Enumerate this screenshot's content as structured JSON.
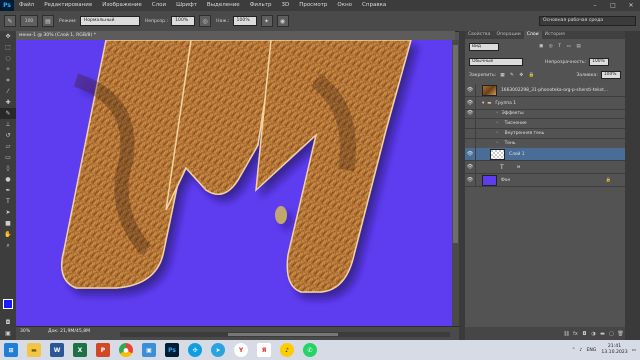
{
  "app": {
    "logo": "Ps"
  },
  "menu": [
    "Файл",
    "Редактирование",
    "Изображение",
    "Слои",
    "Шрифт",
    "Выделение",
    "Фильтр",
    "3D",
    "Просмотр",
    "Окно",
    "Справка"
  ],
  "options": {
    "size": "100",
    "mode_label": "Режим:",
    "mode_value": "Нормальный",
    "opacity_label": "Непрозр.:",
    "opacity_value": "100%",
    "flow_label": "Наж.:",
    "flow_value": "100%",
    "workspace": "Основная рабочая среда"
  },
  "tools": [
    "move-tool-icon",
    "marquee-tool-icon",
    "lasso-tool-icon",
    "quick-select-icon",
    "crop-tool-icon",
    "eyedropper-icon",
    "healing-brush-icon",
    "brush-tool-icon",
    "clone-stamp-icon",
    "history-brush-icon",
    "eraser-icon",
    "gradient-icon",
    "blur-icon",
    "dodge-icon",
    "pen-tool-icon",
    "type-tool-icon",
    "path-select-icon",
    "shape-tool-icon",
    "hand-tool-icon",
    "zoom-tool-icon"
  ],
  "document": {
    "tab_title": "мени-1 @ 30% (Слой 1, RGB/8) *",
    "zoom": "30%",
    "docsize": "Док: 21,9М/45,8М"
  },
  "canvas": {
    "background_color": "#5e3df0",
    "letter": "М"
  },
  "panel": {
    "tabs": [
      "Свойства",
      "Операции",
      "Слои",
      "История"
    ],
    "active_tab": "Слои",
    "filter_kind": "Вид",
    "blend_mode": "Обычные",
    "opacity_label": "Непрозрачность:",
    "opacity_value": "100%",
    "lock_label": "Закрепить:",
    "fill_label": "Заливка:",
    "fill_value": "100%"
  },
  "layers": [
    {
      "name": "1663002298_31-phonoteka-org-p-shersti-tekst...",
      "type": "image",
      "indent": 0
    },
    {
      "name": "Группа 1",
      "type": "group",
      "indent": 0
    },
    {
      "name": "Эффекты",
      "type": "fx",
      "indent": 1
    },
    {
      "name": "Тиснение",
      "type": "fx",
      "indent": 2
    },
    {
      "name": "Внутренняя тень",
      "type": "fx",
      "indent": 2
    },
    {
      "name": "Тень",
      "type": "fx",
      "indent": 2
    },
    {
      "name": "Слой 1",
      "type": "pixel",
      "indent": 1,
      "selected": true
    },
    {
      "name": "м",
      "type": "text",
      "indent": 1
    },
    {
      "name": "Фон",
      "type": "background",
      "indent": 0
    }
  ],
  "taskbar": {
    "apps": [
      "windows-start-icon",
      "file-explorer-icon",
      "word-icon",
      "excel-icon",
      "powerpoint-icon",
      "chrome-icon",
      "photos-icon",
      "photoshop-icon",
      "network-icon",
      "telegram-icon",
      "yandex-icon",
      "yandex-browser-icon",
      "yandex-music-icon",
      "whatsapp-icon"
    ],
    "lang": "ENG",
    "time": "21:41",
    "date": "13.10.2023"
  },
  "colors": {
    "accent": "#31a8ff",
    "canvas": "#5e3df0",
    "selected_layer": "#4a6d98"
  }
}
